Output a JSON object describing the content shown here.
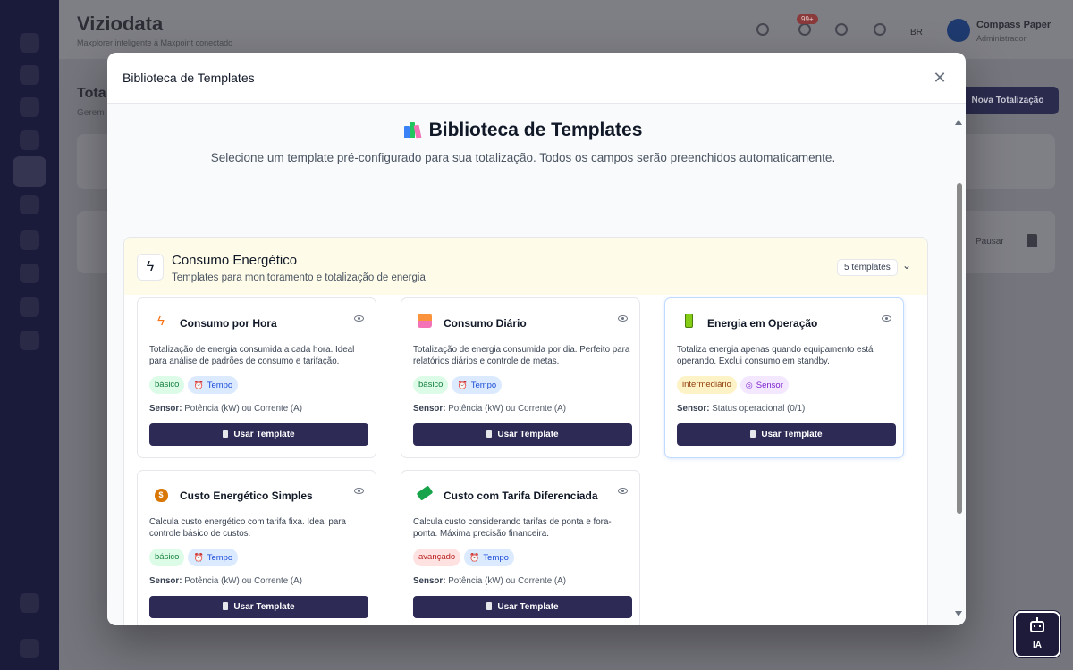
{
  "app": {
    "brand": "Viziodata",
    "brand_sub": "Maxplorer inteligente à Maxpoint conectado",
    "notification_badge": "99+",
    "lang": "BR",
    "user_name": "Compass Paper",
    "user_role": "Administrador",
    "page_title": "Tota",
    "page_sub": "Gerem",
    "new_button": "Nova Totalização",
    "row_action": "Pausar"
  },
  "modal": {
    "title": "Biblioteca de Templates",
    "close_icon": "close-icon",
    "heading": "Biblioteca de Templates",
    "subheading": "Selecione um template pré-configurado para sua totalização. Todos os campos serão preenchidos automaticamente."
  },
  "category": {
    "title": "Consumo Energético",
    "description": "Templates para monitoramento e totalização de energia",
    "count": "5 templates",
    "icon": "lightning-icon"
  },
  "templates": [
    {
      "title": "Consumo por Hora",
      "icon": "lightning-icon",
      "description": "Totalização de energia consumida a cada hora. Ideal para análise de padrões de consumo e tarifação.",
      "level": "básico",
      "trigger": "Tempo",
      "sensor_label": "Sensor:",
      "sensor": "Potência (kW) ou Corrente (A)",
      "button": "Usar Template"
    },
    {
      "title": "Consumo Diário",
      "icon": "sunrise-icon",
      "description": "Totalização de energia consumida por dia. Perfeito para relatórios diários e controle de metas.",
      "level": "básico",
      "trigger": "Tempo",
      "sensor_label": "Sensor:",
      "sensor": "Potência (kW) ou Corrente (A)",
      "button": "Usar Template"
    },
    {
      "title": "Energia em Operação",
      "icon": "battery-icon",
      "description": "Totaliza energia apenas quando equipamento está operando. Exclui consumo em standby.",
      "level": "intermediário",
      "trigger": "Sensor",
      "sensor_label": "Sensor:",
      "sensor": "Status operacional (0/1)",
      "button": "Usar Template"
    },
    {
      "title": "Custo Energético Simples",
      "icon": "money-bag-icon",
      "description": "Calcula custo energético com tarifa fixa. Ideal para controle básico de custos.",
      "level": "básico",
      "trigger": "Tempo",
      "sensor_label": "Sensor:",
      "sensor": "Potência (kW) ou Corrente (A)",
      "button": "Usar Template"
    },
    {
      "title": "Custo com Tarifa Diferenciada",
      "icon": "money-icon",
      "description": "Calcula custo considerando tarifas de ponta e fora-ponta. Máxima precisão financeira.",
      "level": "avançado",
      "trigger": "Tempo",
      "sensor_label": "Sensor:",
      "sensor": "Potência (kW) ou Corrente (A)",
      "button": "Usar Template"
    }
  ],
  "ai_button": {
    "label": "IA",
    "icon": "robot-icon"
  },
  "colors": {
    "primary": "#2d2b56",
    "category_bg": "#fefce8",
    "basic": "#dcfce7",
    "intermediate": "#fef3c7",
    "advanced": "#fee2e2",
    "tempo": "#dbeafe",
    "sensor": "#f3e8ff"
  }
}
